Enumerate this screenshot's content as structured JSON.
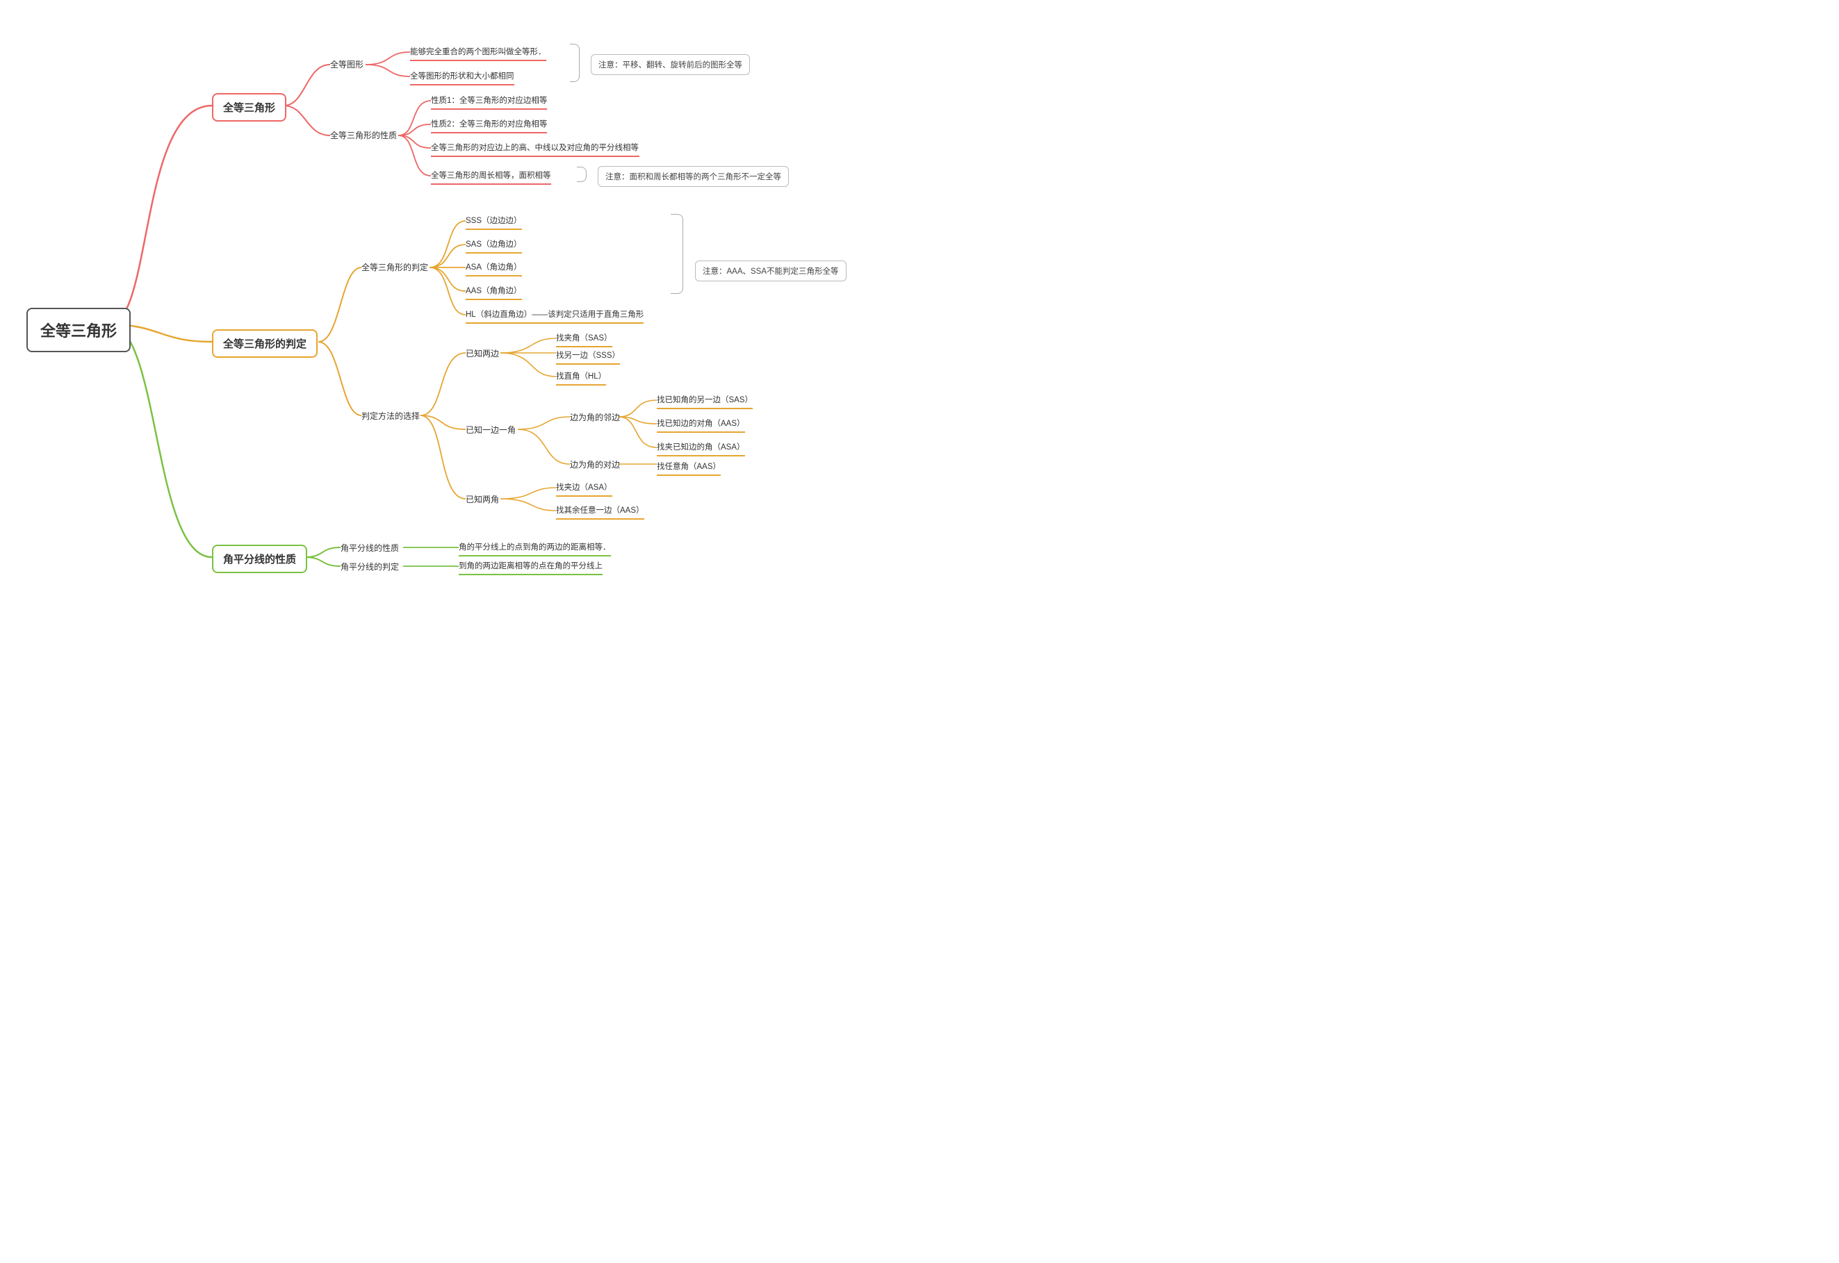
{
  "root": {
    "title": "全等三角形"
  },
  "branches": {
    "b1": {
      "title": "全等三角形",
      "sub1": {
        "label": "全等图形",
        "leaves": [
          "能够完全重合的两个图形叫做全等形．",
          "全等图形的形状和大小都相同"
        ]
      },
      "sub2": {
        "label": "全等三角形的性质",
        "leaves": [
          "性质1：全等三角形的对应边相等",
          "性质2：全等三角形的对应角相等",
          "全等三角形的对应边上的高、中线以及对应角的平分线相等",
          "全等三角形的周长相等，面积相等"
        ]
      },
      "note1": "注意：平移、翻转、旋转前后的图形全等",
      "note2": "注意：面积和周长都相等的两个三角形不一定全等"
    },
    "b2": {
      "title": "全等三角形的判定",
      "sub1": {
        "label": "全等三角形的判定",
        "leaves": [
          "SSS（边边边）",
          "SAS（边角边）",
          "ASA（角边角）",
          "AAS（角角边）",
          "HL（斜边直角边）——该判定只适用于直角三角形"
        ]
      },
      "sub2": {
        "label": "判定方法的选择",
        "c1": {
          "label": "已知两边",
          "leaves": [
            "找夹角（SAS）",
            "找另一边（SSS）",
            "找直角（HL）"
          ]
        },
        "c2": {
          "label": "已知一边一角",
          "d1": {
            "label": "边为角的邻边",
            "leaves": [
              "找已知角的另一边（SAS）",
              "找已知边的对角（AAS）",
              "找夹已知边的角（ASA）"
            ]
          },
          "d2": {
            "label": "边为角的对边",
            "leaves": [
              "找任意角（AAS）"
            ]
          }
        },
        "c3": {
          "label": "已知两角",
          "leaves": [
            "找夹边（ASA）",
            "找其余任意一边（AAS）"
          ]
        }
      },
      "note1": "注意：AAA、SSA不能判定三角形全等"
    },
    "b3": {
      "title": "角平分线的性质",
      "sub1": {
        "label": "角平分线的性质",
        "leaf": "角的平分线上的点到角的两边的距离相等．"
      },
      "sub2": {
        "label": "角平分线的判定",
        "leaf": "到角的两边距离相等的点在角的平分线上"
      }
    }
  }
}
